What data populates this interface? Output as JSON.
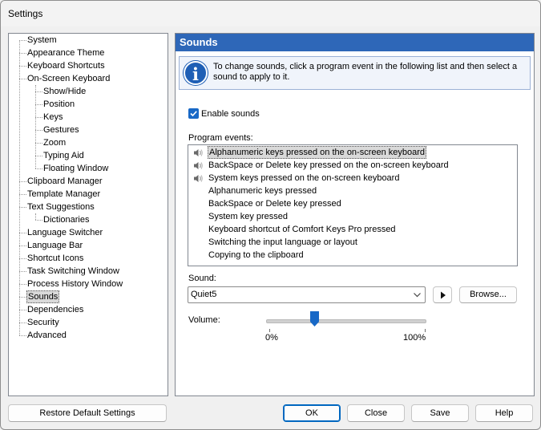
{
  "window": {
    "title": "Settings"
  },
  "tree": {
    "items": [
      {
        "label": "System"
      },
      {
        "label": "Appearance Theme"
      },
      {
        "label": "Keyboard Shortcuts"
      },
      {
        "label": "On-Screen Keyboard"
      },
      {
        "label": "Show/Hide"
      },
      {
        "label": "Position"
      },
      {
        "label": "Keys"
      },
      {
        "label": "Gestures"
      },
      {
        "label": "Zoom"
      },
      {
        "label": "Typing Aid"
      },
      {
        "label": "Floating Window"
      },
      {
        "label": "Clipboard Manager"
      },
      {
        "label": "Template Manager"
      },
      {
        "label": "Text Suggestions"
      },
      {
        "label": "Dictionaries"
      },
      {
        "label": "Language Switcher"
      },
      {
        "label": "Language Bar"
      },
      {
        "label": "Shortcut Icons"
      },
      {
        "label": "Task Switching Window"
      },
      {
        "label": "Process History Window"
      },
      {
        "label": "Sounds"
      },
      {
        "label": "Dependencies"
      },
      {
        "label": "Security"
      },
      {
        "label": "Advanced"
      }
    ],
    "selected": "Sounds"
  },
  "panel": {
    "title": "Sounds",
    "info_text": "To change sounds, click a program event in the following list and then select a sound to apply to it.",
    "enable_sounds_label": "Enable sounds",
    "enable_sounds_checked": true,
    "program_events_label": "Program events:",
    "events": [
      {
        "label": "Alphanumeric keys pressed on the on-screen keyboard",
        "has_sound": true
      },
      {
        "label": "BackSpace or Delete key pressed on the on-screen keyboard",
        "has_sound": true
      },
      {
        "label": "System keys pressed on the on-screen keyboard",
        "has_sound": true
      },
      {
        "label": "Alphanumeric keys pressed",
        "has_sound": false
      },
      {
        "label": "BackSpace or Delete key pressed",
        "has_sound": false
      },
      {
        "label": "System key pressed",
        "has_sound": false
      },
      {
        "label": "Keyboard shortcut of Comfort Keys Pro pressed",
        "has_sound": false
      },
      {
        "label": "Switching the input language or layout",
        "has_sound": false
      },
      {
        "label": "Copying to the clipboard",
        "has_sound": false
      }
    ],
    "selected_event": "Alphanumeric keys pressed on the on-screen keyboard",
    "sound_label": "Sound:",
    "sound_value": "Quiet5",
    "browse_label": "Browse...",
    "volume_label": "Volume:",
    "volume_min_label": "0%",
    "volume_max_label": "100%",
    "volume_fraction": 0.3
  },
  "footer": {
    "restore_label": "Restore Default Settings",
    "ok_label": "OK",
    "close_label": "Close",
    "save_label": "Save",
    "help_label": "Help"
  },
  "colors": {
    "header_bg": "#2e67b8",
    "accent": "#1868c6"
  }
}
